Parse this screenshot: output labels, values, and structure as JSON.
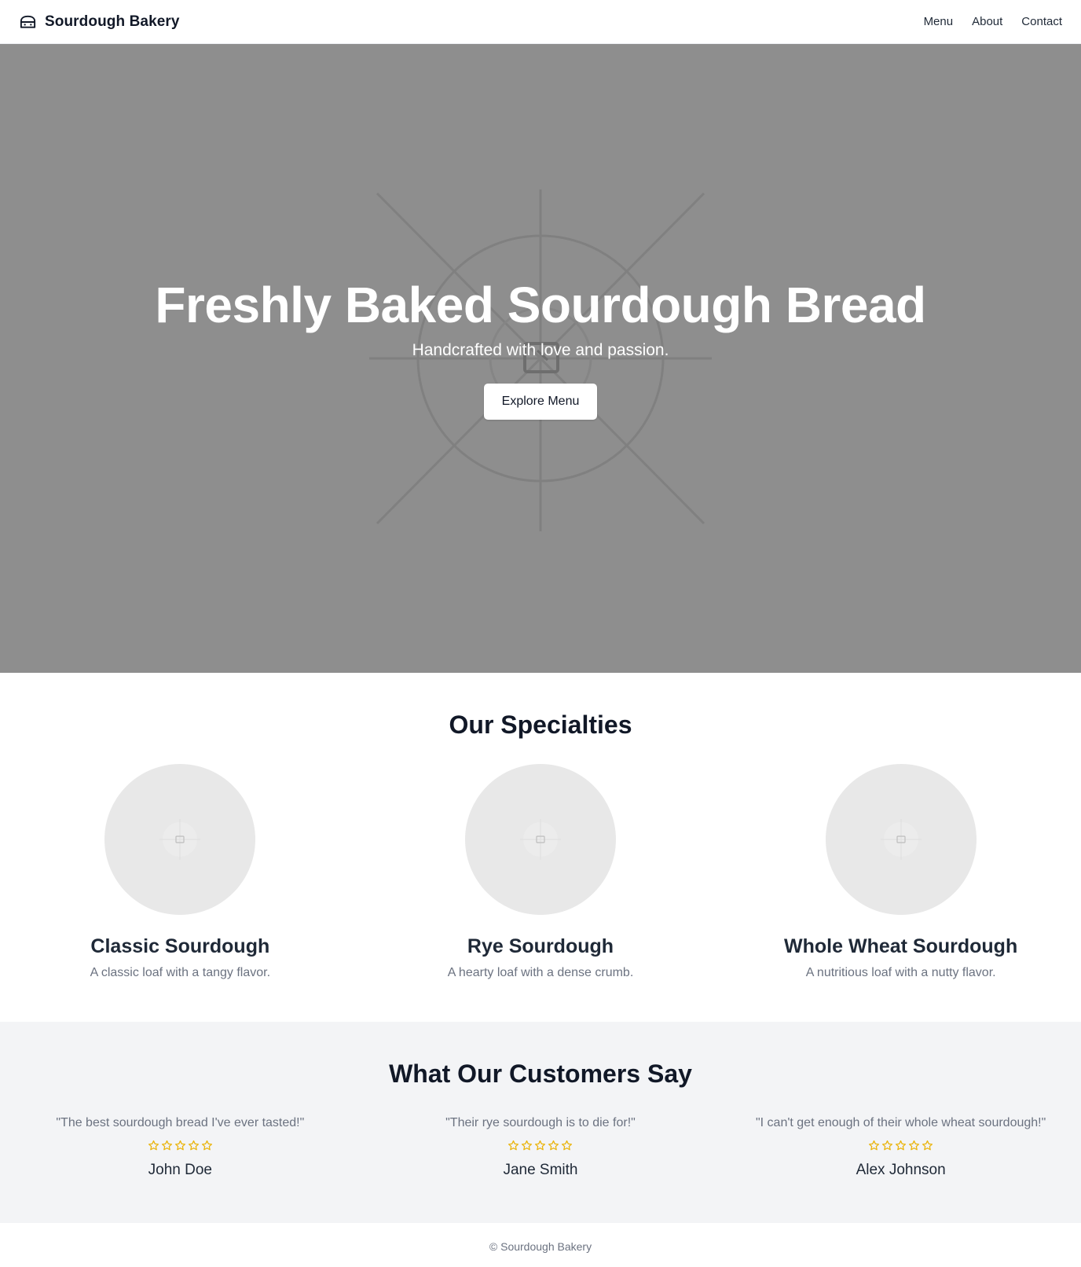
{
  "header": {
    "brand": "Sourdough Bakery",
    "brand_icon": "bread-icon",
    "nav": [
      "Menu",
      "About",
      "Contact"
    ]
  },
  "hero": {
    "title": "Freshly Baked Sourdough Bread",
    "subtitle": "Handcrafted with love and passion.",
    "cta": "Explore Menu",
    "image_icon": "image-placeholder-icon",
    "background_color": "#8e8e8e"
  },
  "specialties": {
    "title": "Our Specialties",
    "items": [
      {
        "name": "Classic Sourdough",
        "description": "A classic loaf with a tangy flavor.",
        "image_icon": "image-placeholder-icon"
      },
      {
        "name": "Rye Sourdough",
        "description": "A hearty loaf with a dense crumb.",
        "image_icon": "image-placeholder-icon"
      },
      {
        "name": "Whole Wheat Sourdough",
        "description": "A nutritious loaf with a nutty flavor.",
        "image_icon": "image-placeholder-icon"
      }
    ]
  },
  "testimonials": {
    "title": "What Our Customers Say",
    "star_color": "#eab308",
    "items": [
      {
        "quote": "\"The best sourdough bread I've ever tasted!\"",
        "rating": 5,
        "author": "John Doe"
      },
      {
        "quote": "\"Their rye sourdough is to die for!\"",
        "rating": 5,
        "author": "Jane Smith"
      },
      {
        "quote": "\"I can't get enough of their whole wheat sourdough!\"",
        "rating": 5,
        "author": "Alex Johnson"
      }
    ]
  },
  "footer": {
    "text": "© Sourdough Bakery"
  }
}
